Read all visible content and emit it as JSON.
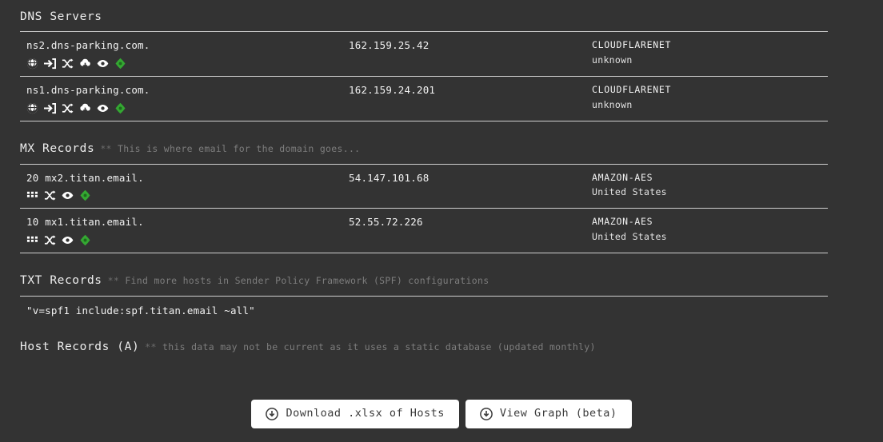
{
  "colors": {
    "background": "#333333",
    "text": "#f2f2f2",
    "muted": "#7d7d7d",
    "rule": "#cfcfcf",
    "accent_green": "#34a832",
    "button_bg": "#ffffff",
    "button_text": "#3a3a3a"
  },
  "sections": {
    "dns_servers": {
      "title": "DNS Servers",
      "note": "",
      "rows": [
        {
          "priority": "",
          "name": "ns2.dns-parking.com.",
          "ip": "162.159.25.42",
          "org": "CLOUDFLARENET",
          "location": "unknown",
          "icons": [
            "globe-icon",
            "sign-in-icon",
            "shuffle-icon",
            "cloud-download-icon",
            "eye-icon",
            "crosshair-diamond-icon"
          ]
        },
        {
          "priority": "",
          "name": "ns1.dns-parking.com.",
          "ip": "162.159.24.201",
          "org": "CLOUDFLARENET",
          "location": "unknown",
          "icons": [
            "globe-icon",
            "sign-in-icon",
            "shuffle-icon",
            "cloud-download-icon",
            "eye-icon",
            "crosshair-diamond-icon"
          ]
        }
      ]
    },
    "mx_records": {
      "title": "MX Records",
      "note_stars": "**",
      "note": "This is where email for the domain goes...",
      "rows": [
        {
          "priority": "20",
          "name": "mx2.titan.email.",
          "ip": "54.147.101.68",
          "org": "AMAZON-AES",
          "location": "United States",
          "icons": [
            "grid-icon",
            "shuffle-icon",
            "eye-icon",
            "crosshair-diamond-icon"
          ]
        },
        {
          "priority": "10",
          "name": "mx1.titan.email.",
          "ip": "52.55.72.226",
          "org": "AMAZON-AES",
          "location": "United States",
          "icons": [
            "grid-icon",
            "shuffle-icon",
            "eye-icon",
            "crosshair-diamond-icon"
          ]
        }
      ]
    },
    "txt_records": {
      "title": "TXT Records",
      "note_stars": "**",
      "note": "Find more hosts in Sender Policy Framework (SPF) configurations",
      "values": [
        "\"v=spf1 include:spf.titan.email ~all\""
      ]
    },
    "host_records": {
      "title": "Host Records (A)",
      "note_stars": "**",
      "note": "this data may not be current as it uses a static database (updated monthly)"
    }
  },
  "buttons": [
    {
      "label": "Download .xlsx of Hosts",
      "icon": "download-circle-icon"
    },
    {
      "label": "View Graph (beta)",
      "icon": "download-circle-icon"
    }
  ]
}
